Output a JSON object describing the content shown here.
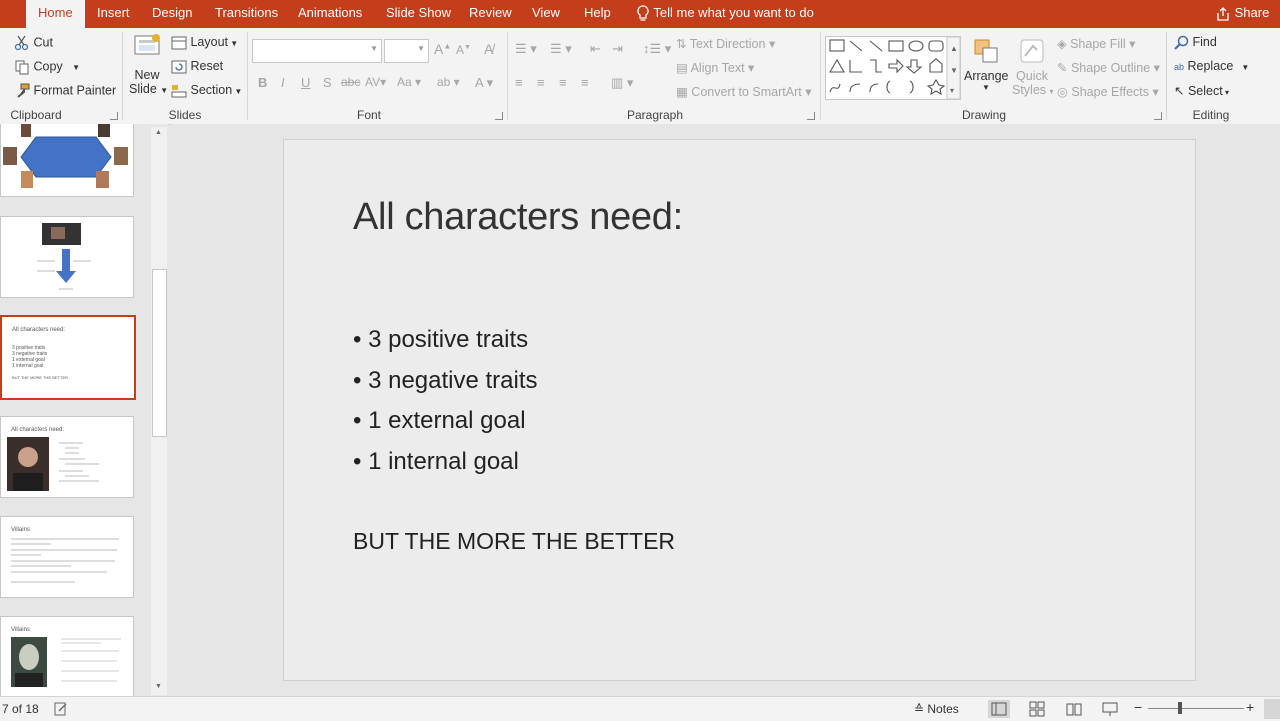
{
  "tabs": [
    "Home",
    "Insert",
    "Design",
    "Transitions",
    "Animations",
    "Slide Show",
    "Review",
    "View",
    "Help"
  ],
  "tellme": "Tell me what you want to do",
  "share": "Share",
  "clipboard": {
    "cut": "Cut",
    "copy": "Copy",
    "format_painter": "Format Painter",
    "label": "Clipboard"
  },
  "slides_group": {
    "new": "New",
    "slide": "Slide",
    "layout": "Layout",
    "reset": "Reset",
    "section": "Section",
    "label": "Slides"
  },
  "font_group": {
    "label": "Font"
  },
  "paragraph_group": {
    "text_direction": "Text Direction",
    "align_text": "Align Text",
    "convert_smartart": "Convert to SmartArt",
    "label": "Paragraph"
  },
  "drawing_group": {
    "arrange": "Arrange",
    "quick": "Quick",
    "styles": "Styles",
    "shape_fill": "Shape Fill",
    "shape_outline": "Shape Outline",
    "shape_effects": "Shape Effects",
    "label": "Drawing"
  },
  "editing_group": {
    "find": "Find",
    "replace": "Replace",
    "select": "Select",
    "label": "Editing"
  },
  "thumbs": [
    {
      "title": "All characters need:",
      "lines": [
        "3 positive traits",
        "3 negative traits",
        "1 external goal",
        "1 internal goal"
      ],
      "footer": "BUT THE MORE THE BETTER"
    },
    {
      "title": "All characters need:"
    },
    {
      "title": "Villains"
    },
    {
      "title": "Villains"
    }
  ],
  "slide": {
    "title": "All characters need:",
    "bullets": [
      "3 positive traits",
      "3 negative traits",
      "1 external goal",
      "1 internal goal"
    ],
    "footer": "BUT THE MORE THE BETTER"
  },
  "status": {
    "slide_counter": "7 of 18",
    "notes": "Notes"
  },
  "colors": {
    "accent": "#c43e1c",
    "selection": "#c43e1c"
  }
}
